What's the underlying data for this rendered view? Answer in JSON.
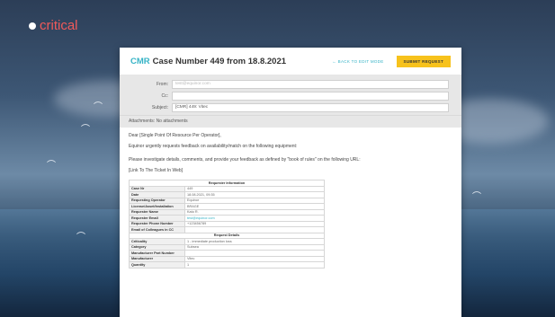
{
  "app": {
    "logo_text": "critical",
    "logo_icon": "circle-dot-icon"
  },
  "header": {
    "brand": "CMR",
    "title": "Case Number 449 from 18.8.2021",
    "back_label": "← BACK TO EDIT MODE",
    "submit_label": "SUBMIT REQUEST"
  },
  "fields": {
    "from_label": "From:",
    "from_value": "test@equinor.com",
    "cc_label": "Cc:",
    "cc_value": "",
    "subject_label": "Subject:",
    "subject_value": "[CMR] 449: Vitec"
  },
  "attachments": "Attachments: No attachments",
  "message": {
    "greeting": "Dear [Single Point Of Resource Per Operator],",
    "line1": "Equinor urgently requests feedback on availability/match on the following equipment:",
    "line2": "Please investigate details, comments, and provide your feedback as defined by \"book of rules\" on the following URL:",
    "link": "[Link To The Ticket In Web]"
  },
  "table": {
    "section1": "Requester Information",
    "rows1": [
      {
        "k": "Case Nr",
        "v": "449"
      },
      {
        "k": "Date",
        "v": "18.08.2021, 09:35"
      },
      {
        "k": "Requesting Operator",
        "v": "Equinor"
      },
      {
        "k": "License/Asset/Installation",
        "v": "BRAGE"
      },
      {
        "k": "Requester Name",
        "v": "Kato R."
      },
      {
        "k": "Requester Email",
        "v": "test@equinor.com"
      },
      {
        "k": "Requester Phone Number",
        "v": "+123456789"
      },
      {
        "k": "Email of Colleagues in CC",
        "v": ""
      }
    ],
    "section2": "Request Details",
    "rows2": [
      {
        "k": "Criticality",
        "v": "1 - immediate production loss"
      },
      {
        "k": "Category",
        "v": "Subsea"
      },
      {
        "k": "Manufacturer Part Number",
        "v": ""
      },
      {
        "k": "Manufacturer",
        "v": "Vitec"
      },
      {
        "k": "Quantity",
        "v": "1"
      }
    ]
  }
}
